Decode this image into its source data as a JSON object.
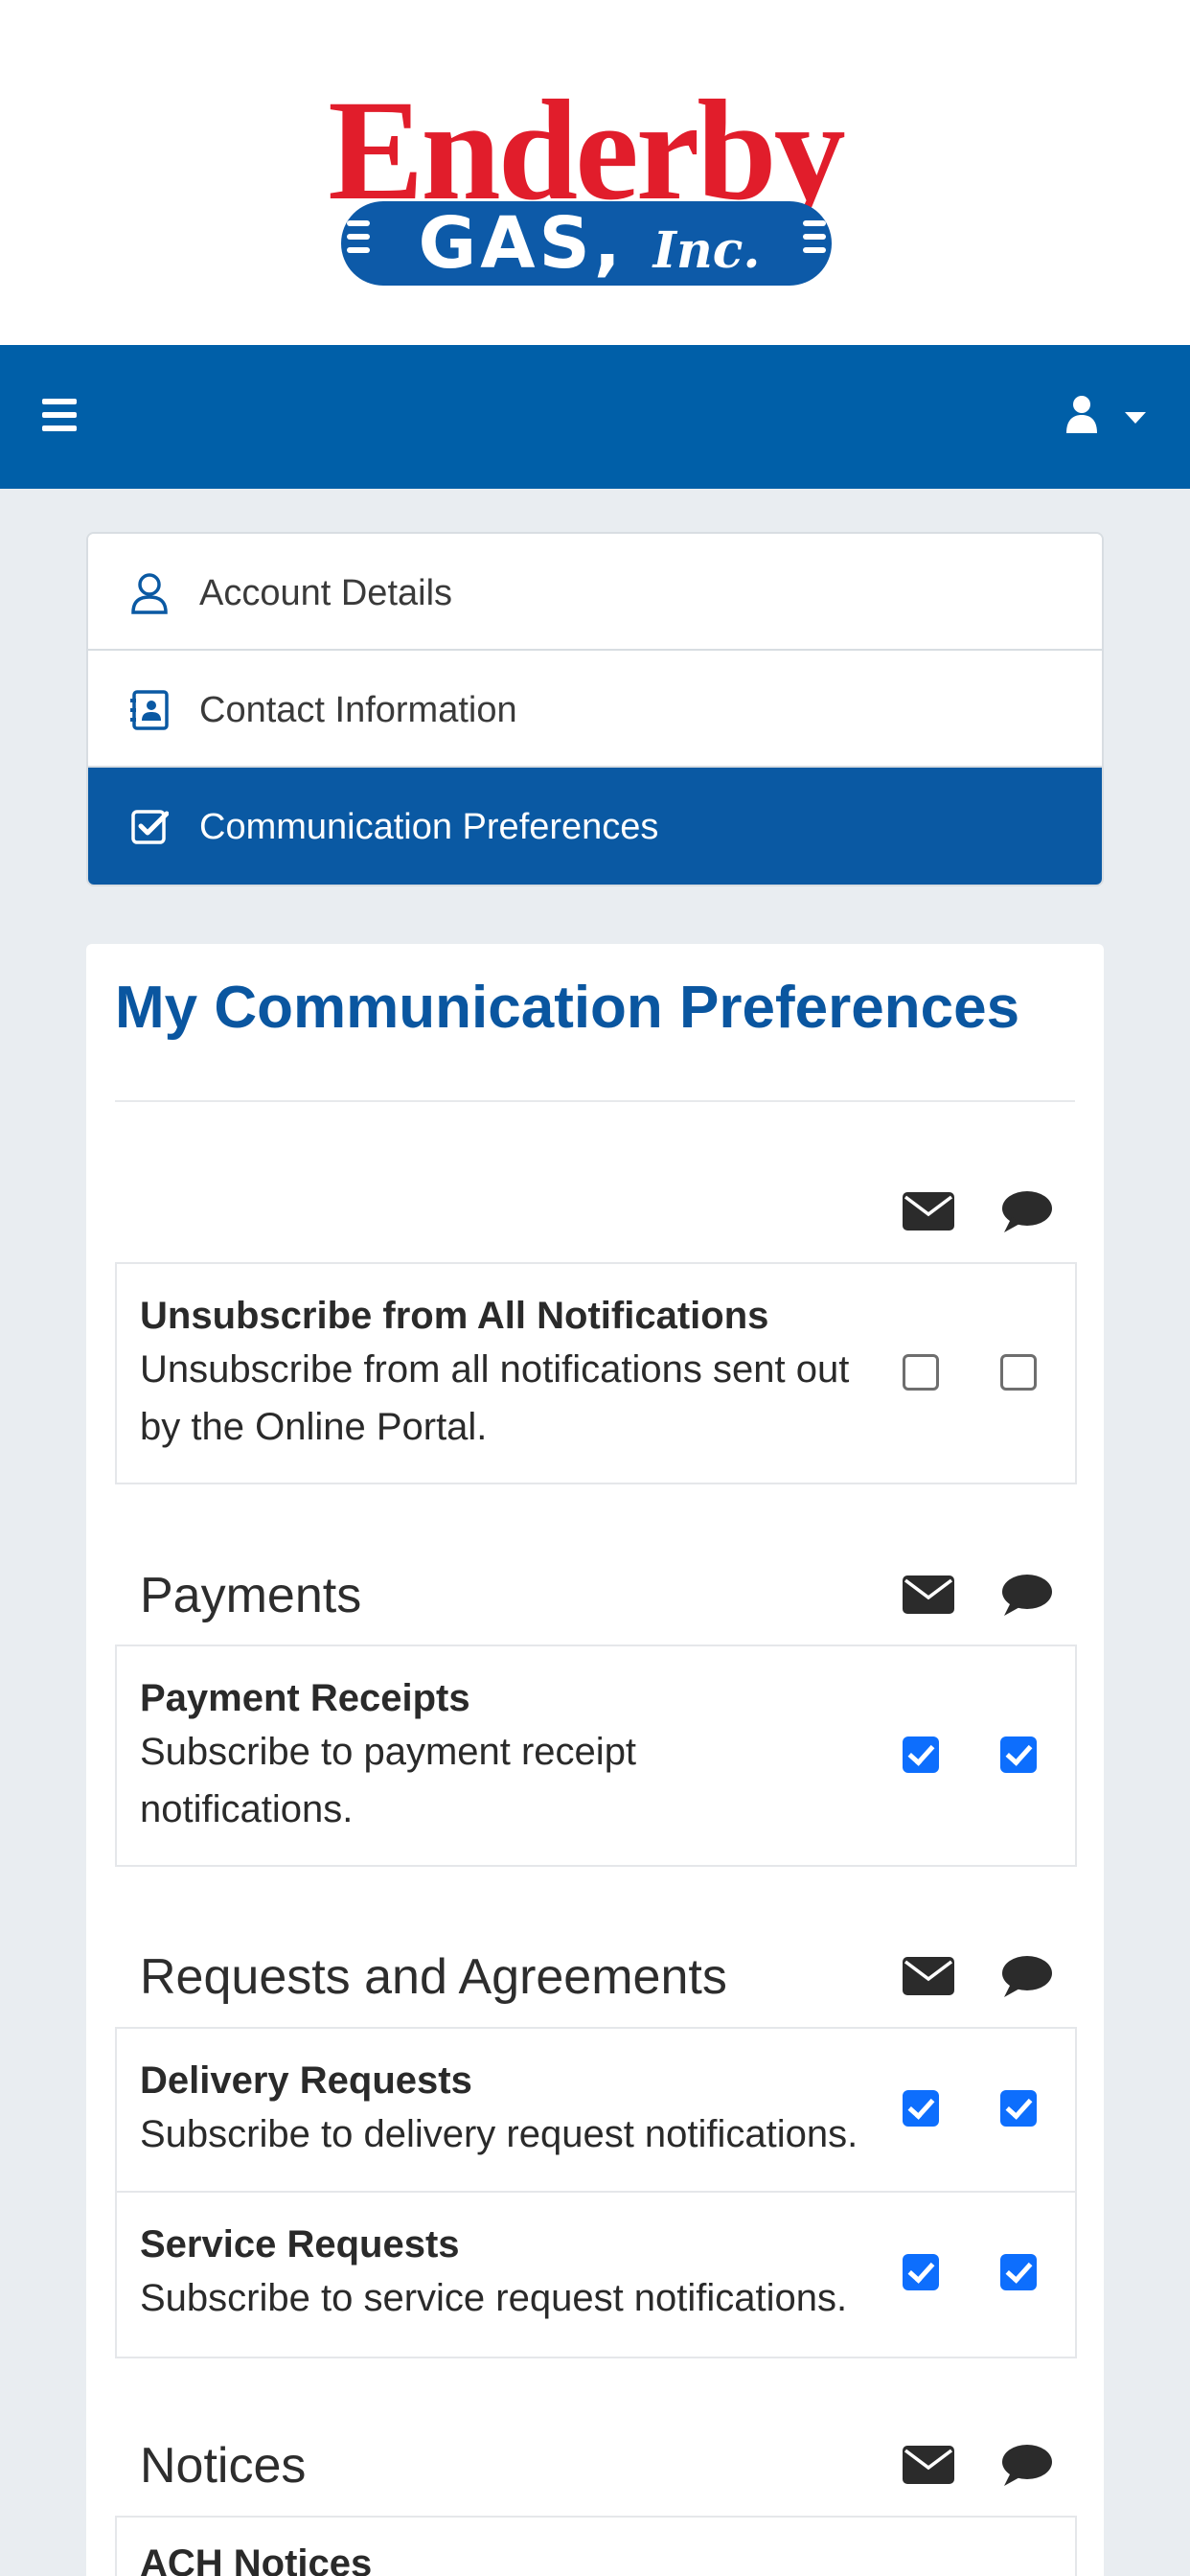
{
  "logo": {
    "word": "Enderby",
    "gas": "GAS,",
    "inc": "Inc."
  },
  "menu": {
    "items": [
      {
        "label": "Account Details",
        "icon": "user-icon",
        "active": false
      },
      {
        "label": "Contact Information",
        "icon": "contact-card-icon",
        "active": false
      },
      {
        "label": "Communication Preferences",
        "icon": "check-square-icon",
        "active": true
      }
    ]
  },
  "page": {
    "title": "My Communication Preferences"
  },
  "columns": {
    "email_icon": "envelope-icon",
    "sms_icon": "chat-bubble-icon"
  },
  "unsubscribe": {
    "name": "Unsubscribe from All Notifications",
    "description": "Unsubscribe from all notifications sent out by the Online Portal.",
    "email": false,
    "sms": false
  },
  "groups": [
    {
      "title": "Payments",
      "items": [
        {
          "name": "Payment Receipts",
          "description": "Subscribe to payment receipt notifications.",
          "email": true,
          "sms": true
        }
      ]
    },
    {
      "title": "Requests and Agreements",
      "items": [
        {
          "name": "Delivery Requests",
          "description": "Subscribe to delivery request notifications.",
          "email": true,
          "sms": true
        },
        {
          "name": "Service Requests",
          "description": "Subscribe to service request notifications.",
          "email": true,
          "sms": true
        }
      ]
    },
    {
      "title": "Notices",
      "items": [
        {
          "name": "ACH Notices"
        }
      ]
    }
  ],
  "colors": {
    "brand_blue": "#005fa8",
    "active_blue": "#0a59a3",
    "title_blue": "#0a56a0",
    "logo_red": "#e11d2b",
    "checkbox_blue": "#0d6efd"
  }
}
